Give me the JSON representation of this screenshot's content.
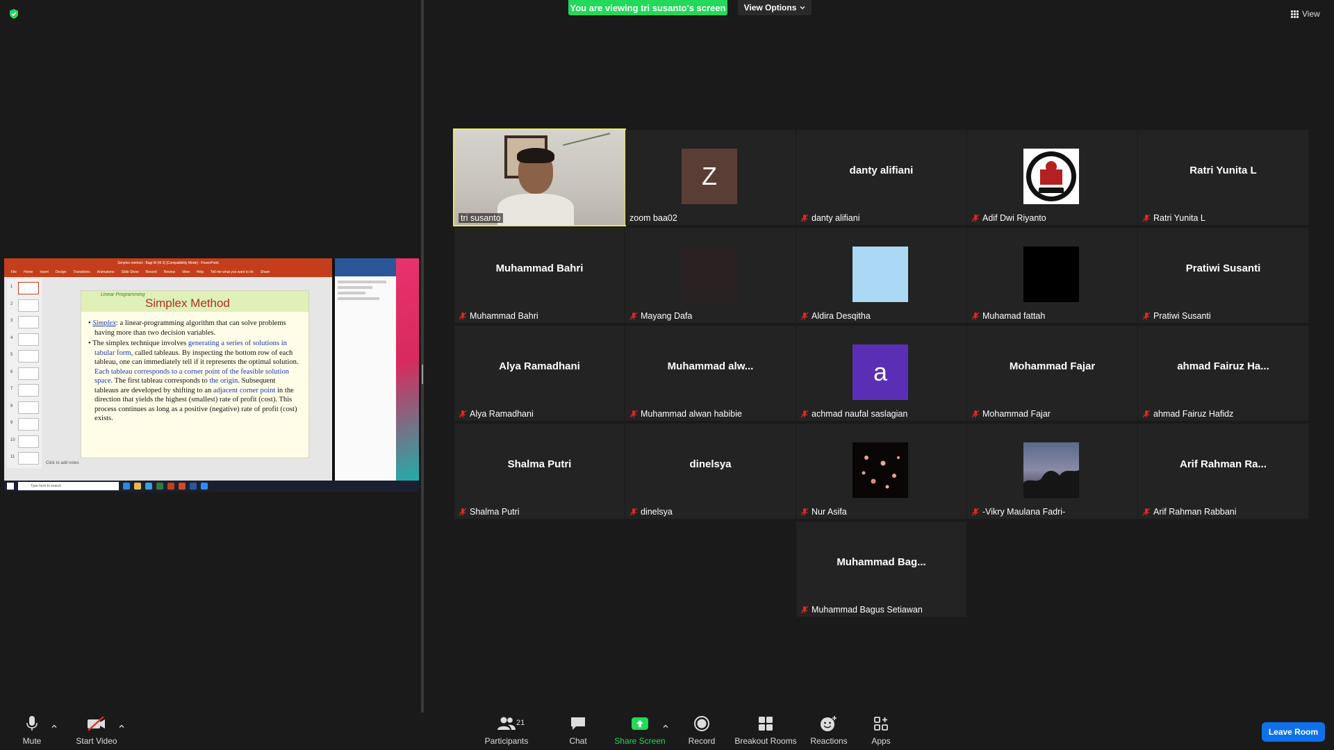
{
  "banner": {
    "text": "You are viewing tri susanto's screen",
    "view_options": "View Options",
    "view": "View"
  },
  "shared_screen": {
    "window_title": "Simplex method - Bagi M (M 3) [Compatibility Mode] - PowerPoint",
    "ribbon_tabs": [
      "File",
      "Home",
      "Insert",
      "Design",
      "Transitions",
      "Animations",
      "Slide Show",
      "Record",
      "Review",
      "View",
      "Help",
      "Tell me what you want to do",
      "Share"
    ],
    "slide_subtitle": "Linear Programming",
    "slide_title": "Simplex Method",
    "bullet1": {
      "term": "Simplex",
      "rest": ": a linear-programming algorithm that can solve problems having more than two decision variables."
    },
    "bullet2": {
      "t1": "The simplex technique involves ",
      "h1": "generating a series of solutions in tabular form",
      "t2": ", called tableaus. By inspecting the bottom row of each tableau, one can immediately tell if it represents the optimal solution. ",
      "h2": "Each tableau corresponds to a corner point of the feasible solution space",
      "t3": ". The first tableau corresponds to ",
      "h3": "the origin",
      "t4": ". Subsequent tableaus are developed by shifting to an ",
      "h4": "adjacent corner point",
      "t5": " in the direction that yields the highest (smallest) rate of profit (cost). This process continues as long as a positive (negative) rate of profit (cost) exists."
    },
    "notes": "Click to add notes",
    "taskbar_search": "Type here to search",
    "thumb_numbers": [
      "1",
      "2",
      "3",
      "4",
      "5",
      "6",
      "7",
      "8",
      "9",
      "10",
      "11"
    ]
  },
  "participants": [
    {
      "display": "",
      "label": "tri susanto",
      "muted": false,
      "type": "video",
      "active": true
    },
    {
      "display": "Z",
      "label": "zoom baa02",
      "muted": false,
      "type": "avatar",
      "color": "#5a3d35"
    },
    {
      "display": "danty alifiani",
      "label": "danty alifiani",
      "muted": true,
      "type": "name"
    },
    {
      "display": "",
      "label": "Adif Dwi Riyanto",
      "muted": true,
      "type": "logo"
    },
    {
      "display": "Ratri Yunita L",
      "label": "Ratri Yunita L",
      "muted": true,
      "type": "name"
    },
    {
      "display": "Muhammad Bahri",
      "label": "Muhammad Bahri",
      "muted": true,
      "type": "name"
    },
    {
      "display": "",
      "label": "Mayang Dafa",
      "muted": true,
      "type": "avatar",
      "color": "#2a2222"
    },
    {
      "display": "",
      "label": "Aldira Desqitha",
      "muted": true,
      "type": "avatar",
      "color": "#aad8f5"
    },
    {
      "display": "",
      "label": "Muhamad fattah",
      "muted": true,
      "type": "avatar",
      "color": "#000000"
    },
    {
      "display": "Pratiwi Susanti",
      "label": "Pratiwi Susanti",
      "muted": true,
      "type": "name"
    },
    {
      "display": "Alya Ramadhani",
      "label": "Alya Ramadhani",
      "muted": true,
      "type": "name"
    },
    {
      "display": "Muhammad  alw...",
      "label": "Muhammad alwan habibie",
      "muted": true,
      "type": "name"
    },
    {
      "display": "a",
      "label": "achmad naufal saslagian",
      "muted": true,
      "type": "avatar",
      "color": "#5b2fb5"
    },
    {
      "display": "Mohammad Fajar",
      "label": "Mohammad Fajar",
      "muted": true,
      "type": "name"
    },
    {
      "display": "ahmad  Fairuz  Ha...",
      "label": "ahmad Fairuz Hafidz",
      "muted": true,
      "type": "name"
    },
    {
      "display": "Shalma Putri",
      "label": "Shalma Putri",
      "muted": true,
      "type": "name"
    },
    {
      "display": "dinelsya",
      "label": "dinelsya",
      "muted": true,
      "type": "name"
    },
    {
      "display": "",
      "label": "Nur Asifa",
      "muted": true,
      "type": "photo-dark"
    },
    {
      "display": "",
      "label": "-Vikry Maulana Fadri-",
      "muted": true,
      "type": "photo-sky"
    },
    {
      "display": "Arif  Rahman  Ra...",
      "label": "Arif Rahman Rabbani",
      "muted": true,
      "type": "name"
    },
    {
      "display": "Muhammad  Bag...",
      "label": "Muhammad Bagus Setiawan",
      "muted": true,
      "type": "name"
    }
  ],
  "toolbar": {
    "mute": "Mute",
    "start_video": "Start Video",
    "participants": "Participants",
    "participant_count": "21",
    "chat": "Chat",
    "share_screen": "Share Screen",
    "record": "Record",
    "breakout_rooms": "Breakout Rooms",
    "reactions": "Reactions",
    "apps": "Apps",
    "leave_room": "Leave Room"
  },
  "colors": {
    "accent_green": "#23d959",
    "leave_blue": "#0e71eb",
    "active_speaker": "#e8ef4c",
    "mute_red": "#e02828"
  },
  "icons": [
    "shield-check-icon",
    "grid-icon",
    "chevron-down-icon",
    "mic-icon",
    "video-off-icon",
    "people-icon",
    "chat-icon",
    "share-arrow-icon",
    "record-icon",
    "breakout-grid-icon",
    "reaction-smile-icon",
    "apps-icon",
    "mic-off-icon"
  ]
}
